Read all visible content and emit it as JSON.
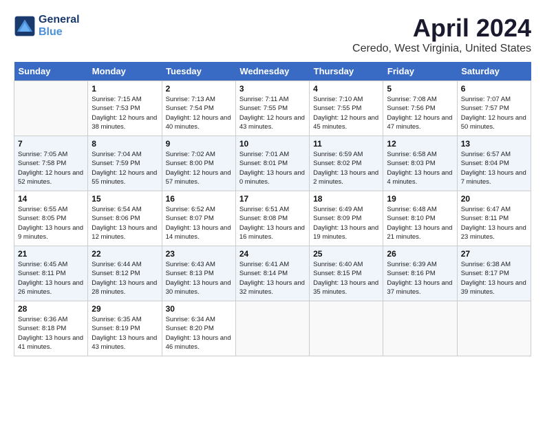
{
  "logo": {
    "line1": "General",
    "line2": "Blue"
  },
  "title": "April 2024",
  "subtitle": "Ceredo, West Virginia, United States",
  "weekdays": [
    "Sunday",
    "Monday",
    "Tuesday",
    "Wednesday",
    "Thursday",
    "Friday",
    "Saturday"
  ],
  "weeks": [
    [
      {
        "day": "",
        "sunrise": "",
        "sunset": "",
        "daylight": ""
      },
      {
        "day": "1",
        "sunrise": "Sunrise: 7:15 AM",
        "sunset": "Sunset: 7:53 PM",
        "daylight": "Daylight: 12 hours and 38 minutes."
      },
      {
        "day": "2",
        "sunrise": "Sunrise: 7:13 AM",
        "sunset": "Sunset: 7:54 PM",
        "daylight": "Daylight: 12 hours and 40 minutes."
      },
      {
        "day": "3",
        "sunrise": "Sunrise: 7:11 AM",
        "sunset": "Sunset: 7:55 PM",
        "daylight": "Daylight: 12 hours and 43 minutes."
      },
      {
        "day": "4",
        "sunrise": "Sunrise: 7:10 AM",
        "sunset": "Sunset: 7:55 PM",
        "daylight": "Daylight: 12 hours and 45 minutes."
      },
      {
        "day": "5",
        "sunrise": "Sunrise: 7:08 AM",
        "sunset": "Sunset: 7:56 PM",
        "daylight": "Daylight: 12 hours and 47 minutes."
      },
      {
        "day": "6",
        "sunrise": "Sunrise: 7:07 AM",
        "sunset": "Sunset: 7:57 PM",
        "daylight": "Daylight: 12 hours and 50 minutes."
      }
    ],
    [
      {
        "day": "7",
        "sunrise": "Sunrise: 7:05 AM",
        "sunset": "Sunset: 7:58 PM",
        "daylight": "Daylight: 12 hours and 52 minutes."
      },
      {
        "day": "8",
        "sunrise": "Sunrise: 7:04 AM",
        "sunset": "Sunset: 7:59 PM",
        "daylight": "Daylight: 12 hours and 55 minutes."
      },
      {
        "day": "9",
        "sunrise": "Sunrise: 7:02 AM",
        "sunset": "Sunset: 8:00 PM",
        "daylight": "Daylight: 12 hours and 57 minutes."
      },
      {
        "day": "10",
        "sunrise": "Sunrise: 7:01 AM",
        "sunset": "Sunset: 8:01 PM",
        "daylight": "Daylight: 13 hours and 0 minutes."
      },
      {
        "day": "11",
        "sunrise": "Sunrise: 6:59 AM",
        "sunset": "Sunset: 8:02 PM",
        "daylight": "Daylight: 13 hours and 2 minutes."
      },
      {
        "day": "12",
        "sunrise": "Sunrise: 6:58 AM",
        "sunset": "Sunset: 8:03 PM",
        "daylight": "Daylight: 13 hours and 4 minutes."
      },
      {
        "day": "13",
        "sunrise": "Sunrise: 6:57 AM",
        "sunset": "Sunset: 8:04 PM",
        "daylight": "Daylight: 13 hours and 7 minutes."
      }
    ],
    [
      {
        "day": "14",
        "sunrise": "Sunrise: 6:55 AM",
        "sunset": "Sunset: 8:05 PM",
        "daylight": "Daylight: 13 hours and 9 minutes."
      },
      {
        "day": "15",
        "sunrise": "Sunrise: 6:54 AM",
        "sunset": "Sunset: 8:06 PM",
        "daylight": "Daylight: 13 hours and 12 minutes."
      },
      {
        "day": "16",
        "sunrise": "Sunrise: 6:52 AM",
        "sunset": "Sunset: 8:07 PM",
        "daylight": "Daylight: 13 hours and 14 minutes."
      },
      {
        "day": "17",
        "sunrise": "Sunrise: 6:51 AM",
        "sunset": "Sunset: 8:08 PM",
        "daylight": "Daylight: 13 hours and 16 minutes."
      },
      {
        "day": "18",
        "sunrise": "Sunrise: 6:49 AM",
        "sunset": "Sunset: 8:09 PM",
        "daylight": "Daylight: 13 hours and 19 minutes."
      },
      {
        "day": "19",
        "sunrise": "Sunrise: 6:48 AM",
        "sunset": "Sunset: 8:10 PM",
        "daylight": "Daylight: 13 hours and 21 minutes."
      },
      {
        "day": "20",
        "sunrise": "Sunrise: 6:47 AM",
        "sunset": "Sunset: 8:11 PM",
        "daylight": "Daylight: 13 hours and 23 minutes."
      }
    ],
    [
      {
        "day": "21",
        "sunrise": "Sunrise: 6:45 AM",
        "sunset": "Sunset: 8:11 PM",
        "daylight": "Daylight: 13 hours and 26 minutes."
      },
      {
        "day": "22",
        "sunrise": "Sunrise: 6:44 AM",
        "sunset": "Sunset: 8:12 PM",
        "daylight": "Daylight: 13 hours and 28 minutes."
      },
      {
        "day": "23",
        "sunrise": "Sunrise: 6:43 AM",
        "sunset": "Sunset: 8:13 PM",
        "daylight": "Daylight: 13 hours and 30 minutes."
      },
      {
        "day": "24",
        "sunrise": "Sunrise: 6:41 AM",
        "sunset": "Sunset: 8:14 PM",
        "daylight": "Daylight: 13 hours and 32 minutes."
      },
      {
        "day": "25",
        "sunrise": "Sunrise: 6:40 AM",
        "sunset": "Sunset: 8:15 PM",
        "daylight": "Daylight: 13 hours and 35 minutes."
      },
      {
        "day": "26",
        "sunrise": "Sunrise: 6:39 AM",
        "sunset": "Sunset: 8:16 PM",
        "daylight": "Daylight: 13 hours and 37 minutes."
      },
      {
        "day": "27",
        "sunrise": "Sunrise: 6:38 AM",
        "sunset": "Sunset: 8:17 PM",
        "daylight": "Daylight: 13 hours and 39 minutes."
      }
    ],
    [
      {
        "day": "28",
        "sunrise": "Sunrise: 6:36 AM",
        "sunset": "Sunset: 8:18 PM",
        "daylight": "Daylight: 13 hours and 41 minutes."
      },
      {
        "day": "29",
        "sunrise": "Sunrise: 6:35 AM",
        "sunset": "Sunset: 8:19 PM",
        "daylight": "Daylight: 13 hours and 43 minutes."
      },
      {
        "day": "30",
        "sunrise": "Sunrise: 6:34 AM",
        "sunset": "Sunset: 8:20 PM",
        "daylight": "Daylight: 13 hours and 46 minutes."
      },
      {
        "day": "",
        "sunrise": "",
        "sunset": "",
        "daylight": ""
      },
      {
        "day": "",
        "sunrise": "",
        "sunset": "",
        "daylight": ""
      },
      {
        "day": "",
        "sunrise": "",
        "sunset": "",
        "daylight": ""
      },
      {
        "day": "",
        "sunrise": "",
        "sunset": "",
        "daylight": ""
      }
    ]
  ]
}
